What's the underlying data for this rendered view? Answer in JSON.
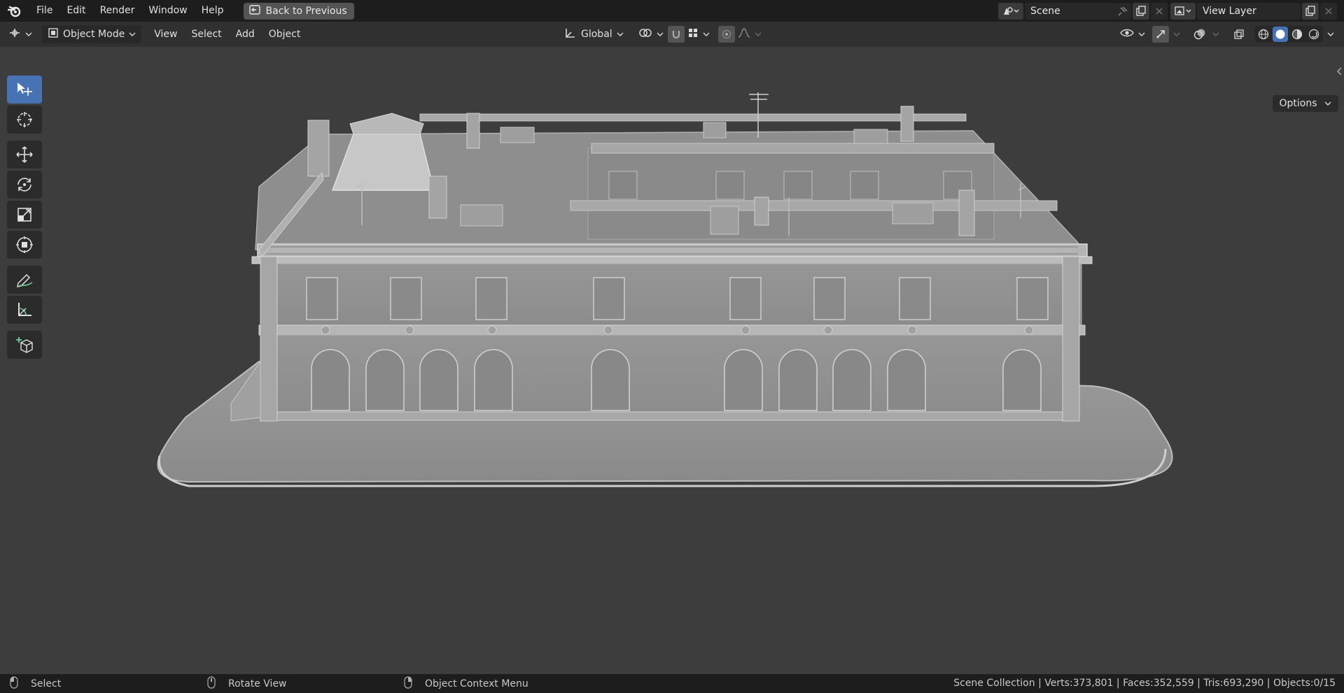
{
  "menu": {
    "file": "File",
    "edit": "Edit",
    "render": "Render",
    "window": "Window",
    "help": "Help",
    "back_to_previous": "Back to Previous"
  },
  "scene": {
    "name": "Scene"
  },
  "view_layer": {
    "name": "View Layer"
  },
  "header": {
    "mode": "Object Mode",
    "view": "View",
    "select": "Select",
    "add": "Add",
    "object": "Object",
    "orientation": "Global"
  },
  "viewport": {
    "options_label": "Options"
  },
  "status": {
    "select": "Select",
    "rotate_view": "Rotate View",
    "context_menu": "Object Context Menu",
    "stats": "Scene Collection | Verts:373,801 | Faces:352,559 | Tris:693,290 | Objects:0/15"
  },
  "colors": {
    "accent": "#4772b3",
    "topbar": "#1d1d1d",
    "viewport": "#3d3d3d"
  }
}
